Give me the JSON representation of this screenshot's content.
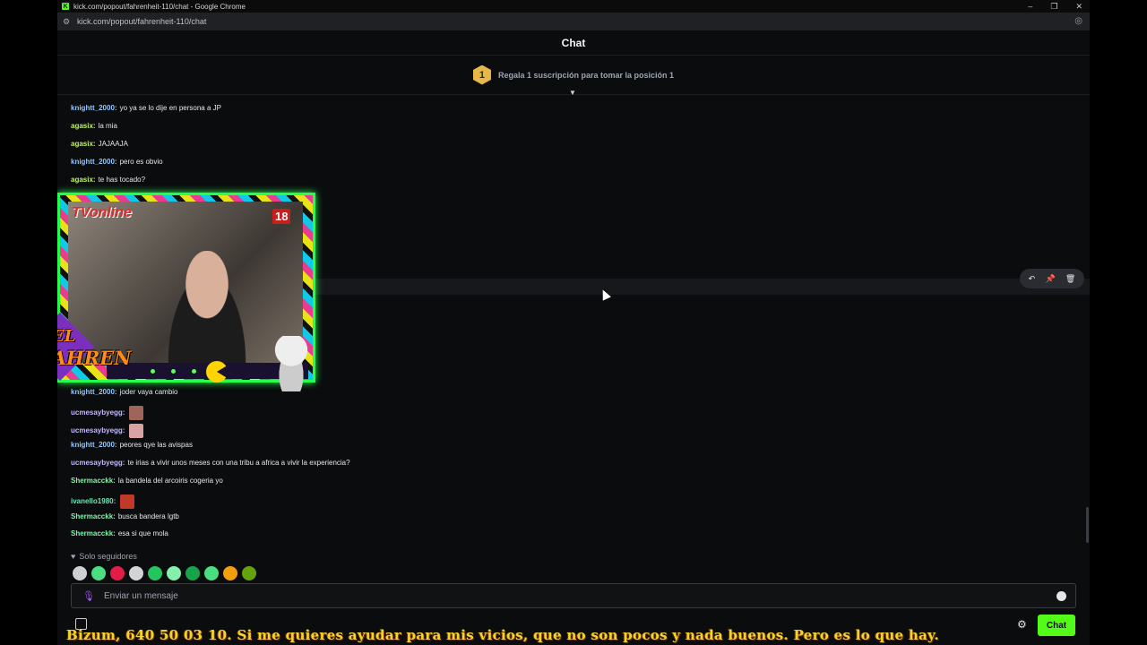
{
  "browser": {
    "window_title": "kick.com/popout/fahrenheit-110/chat - Google Chrome",
    "url": "kick.com/popout/fahrenheit-110/chat",
    "controls": {
      "minimize": "–",
      "restore": "❐",
      "close": "✕"
    }
  },
  "chat": {
    "title": "Chat",
    "leaderboard": {
      "position": "1",
      "text": "Regala 1 suscripción para tomar la posición 1"
    },
    "messages_top": [
      {
        "user": "knightt_2000",
        "color": "#93c5fd",
        "text": "yo ya se lo dije en persona a JP"
      },
      {
        "user": "agasix",
        "color": "#bef264",
        "text": "la mia"
      },
      {
        "user": "agasix",
        "color": "#bef264",
        "text": "JAJAAJA"
      },
      {
        "user": "knightt_2000",
        "color": "#93c5fd",
        "text": "pero es obvio"
      },
      {
        "user": "agasix",
        "color": "#bef264",
        "text": "te has tocado?"
      }
    ],
    "messages_bottom": [
      {
        "user": "knightt_2000",
        "color": "#93c5fd",
        "text": "joder vaya cambio"
      },
      {
        "user": "ucmesaybyegg",
        "color": "#c4b5fd",
        "text": "",
        "emote": "#a0655a"
      },
      {
        "user": "ucmesaybyegg",
        "color": "#c4b5fd",
        "text": "",
        "emote": "#d9a3a3"
      },
      {
        "user": "knightt_2000",
        "color": "#93c5fd",
        "text": "peores qye las avispas"
      },
      {
        "user": "ucmesaybyegg",
        "color": "#c4b5fd",
        "text": "te irias a vivir unos meses con una tribu a africa a vivir la experiencia?"
      },
      {
        "user": "Shermacckk",
        "color": "#86efac",
        "text": "la bandela del arcoiris cogeria yo"
      },
      {
        "user": "ivanello1980",
        "color": "#6ee7b7",
        "text": "",
        "emote": "#c0392b"
      },
      {
        "user": "Shermacckk",
        "color": "#86efac",
        "text": "busca bandera lgtb"
      },
      {
        "user": "Shermacckk",
        "color": "#86efac",
        "text": "esa si que mola"
      }
    ],
    "message_actions": [
      "reply-icon",
      "pin-icon",
      "delete-icon"
    ],
    "followers_only": "Solo seguidores",
    "quick_emotes": [
      "#cfcfcf",
      "#4ade80",
      "#e11d48",
      "#d4d4d4",
      "#22c55e",
      "#86efac",
      "#16a34a",
      "#4ade80",
      "#f59e0b",
      "#65a30d"
    ],
    "input_placeholder": "Enviar un mensaje",
    "send_button": "Chat"
  },
  "overlay": {
    "tv_label": "TVonline",
    "age_label": "18",
    "logo_line1": "EL",
    "logo_line2": "FAHREN",
    "ticker": "Bizum, 640 50 03 10.  Si me quieres ayudar para mis vicios, que no son pocos y nada buenos. Pero es lo que hay."
  },
  "colors": {
    "accent": "#53fc18",
    "background": "#0b0c0e"
  }
}
